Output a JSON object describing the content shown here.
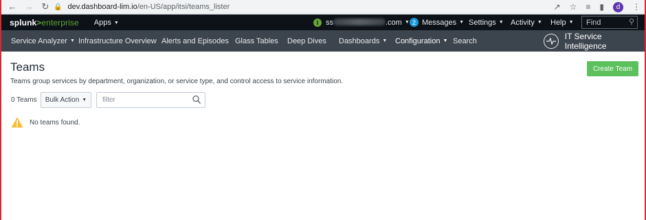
{
  "browser": {
    "url_host": "dev.dashboard-lim.io",
    "url_path": "/en-US/app/itsi/teams_lister",
    "profile_initial": "d"
  },
  "top_bar": {
    "brand_splunk": "splunk",
    "brand_separator": ">",
    "brand_product": "enterprise",
    "apps_label": "Apps",
    "user_prefix": "ss",
    "user_suffix": ".com",
    "status_badge": "i",
    "messages_count": "2",
    "messages_label": "Messages",
    "settings_label": "Settings",
    "activity_label": "Activity",
    "help_label": "Help",
    "find_placeholder": "Find"
  },
  "app_nav": {
    "items": [
      {
        "label": "Service Analyzer",
        "dropdown": true
      },
      {
        "label": "Infrastructure Overview",
        "dropdown": false
      },
      {
        "label": "Alerts and Episodes",
        "dropdown": false
      },
      {
        "label": "Glass Tables",
        "dropdown": false
      },
      {
        "label": "Deep Dives",
        "dropdown": false
      },
      {
        "label": "Dashboards",
        "dropdown": true
      },
      {
        "label": "Configuration",
        "dropdown": true
      },
      {
        "label": "Search",
        "dropdown": false
      }
    ],
    "app_title": "IT Service Intelligence"
  },
  "page": {
    "title": "Teams",
    "description": "Teams group services by department, organization, or service type, and control access to service information.",
    "create_button": "Create Team",
    "teams_count": "0 Teams",
    "bulk_action_label": "Bulk Action",
    "filter_placeholder": "filter",
    "empty_message": "No teams found."
  },
  "colors": {
    "create_button": "#5cc05c",
    "app_bar": "#0c1218",
    "nav_bar": "#3c444d",
    "brand_accent": "#65a637",
    "messages_badge": "#1a9bd9",
    "warning": "#f8be34"
  }
}
